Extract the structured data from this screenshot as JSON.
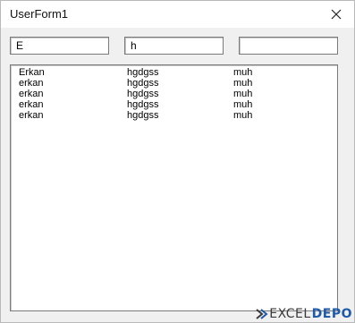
{
  "window": {
    "title": "UserForm1"
  },
  "inputs": [
    {
      "value": "E"
    },
    {
      "value": "h"
    },
    {
      "value": ""
    }
  ],
  "list": {
    "rows": [
      [
        "Erkan",
        "hgdgss",
        "muh"
      ],
      [
        "erkan",
        "hgdgss",
        "muh"
      ],
      [
        "erkan",
        "hgdgss",
        "muh"
      ],
      [
        "erkan",
        "hgdgss",
        "muh"
      ],
      [
        "erkan",
        "hgdgss",
        "muh"
      ]
    ]
  },
  "watermark": {
    "part1": "EXCEL",
    "part2": "DEPO"
  }
}
